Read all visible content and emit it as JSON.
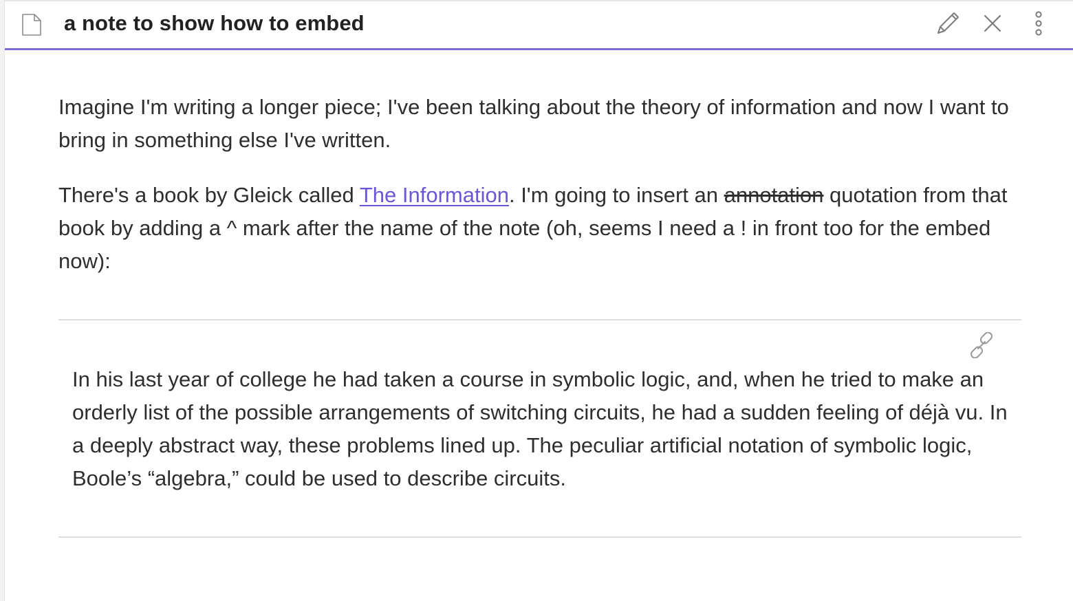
{
  "header": {
    "title": "a note to show how to embed",
    "icons": {
      "file": "file-icon",
      "edit": "pencil-icon",
      "close": "close-icon",
      "more": "more-vertical-icon"
    },
    "accent_color": "#7b6cd9"
  },
  "body": {
    "paragraph1": "Imagine I'm writing a longer piece; I've been talking about the theory of information and now I want to bring in something else I've written.",
    "paragraph2": {
      "before_link": "There's a book by Gleick called ",
      "link_text": "The Information",
      "after_link": ". I'm going to insert an ",
      "strikethrough": "annotation",
      "after_strike": " quotation from that book by adding a ^ mark after the name of the note (oh, seems I need a ! in front too for the embed now):"
    },
    "link_color": "#6b57d6"
  },
  "embed": {
    "link_icon": "link-icon",
    "quote": "In his last year of college he had taken a course in symbolic logic, and, when he tried to make an orderly list of the possible arrangements of switching circuits, he had a sudden feeling of déjà vu. In a deeply abstract way, these problems lined up. The peculiar artificial notation of symbolic logic, Boole’s “algebra,” could be used to describe circuits."
  }
}
